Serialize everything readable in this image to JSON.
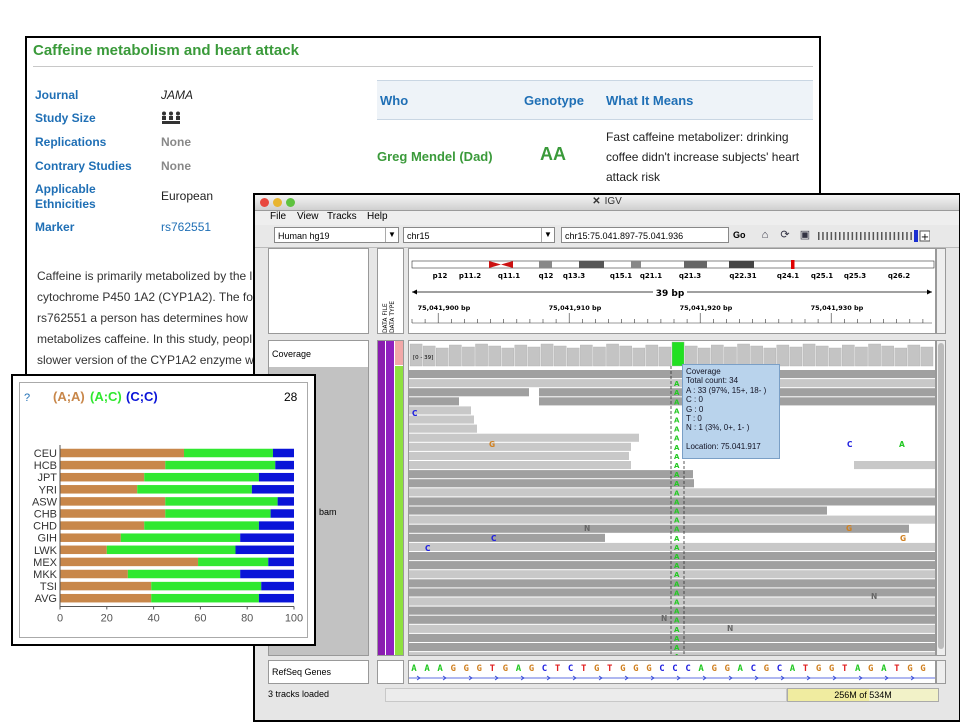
{
  "snpedia": {
    "title": "Caffeine metabolism and heart attack",
    "fields": [
      {
        "key": "Journal",
        "value": "JAMA",
        "style": "ital"
      },
      {
        "key": "Study Size",
        "value": "",
        "style": "icon"
      },
      {
        "key": "Replications",
        "value": "None",
        "style": "gray"
      },
      {
        "key": "Contrary Studies",
        "value": "None",
        "style": "gray"
      },
      {
        "key": "Applicable Ethnicities",
        "value": "European",
        "style": "plain"
      },
      {
        "key": "Marker",
        "value": "rs762551",
        "style": "link"
      }
    ],
    "table": {
      "headers": [
        "Who",
        "Genotype",
        "What It Means"
      ],
      "row": {
        "who": "Greg Mendel (Dad)",
        "genotype": "AA",
        "meaning": "Fast caffeine metabolizer: drinking coffee didn't increase subjects' heart attack risk"
      }
    },
    "body_lines": [
      "Caffeine is primarily metabolized by the l",
      "cytochrome P450 1A2 (CYP1A2). The fo",
      "rs762551 a person has determines how",
      "metabolizes caffeine. In this study, peopl",
      "slower version of the CYP1A2 enzyme w"
    ]
  },
  "chart": {
    "question_mark": "?",
    "count": "28",
    "legend": [
      {
        "label": "(A;A)",
        "color": "#c8874a"
      },
      {
        "label": "(A;C)",
        "color": "#30e830"
      },
      {
        "label": "(C;C)",
        "color": "#0a14d8"
      }
    ]
  },
  "chart_data": {
    "type": "bar",
    "orientation": "horizontal",
    "stacked": true,
    "categories": [
      "CEU",
      "HCB",
      "JPT",
      "YRI",
      "ASW",
      "CHB",
      "CHD",
      "GIH",
      "LWK",
      "MEX",
      "MKK",
      "TSI",
      "AVG"
    ],
    "series": [
      {
        "name": "(A;A)",
        "values": [
          53,
          45,
          36,
          33,
          45,
          45,
          36,
          26,
          20,
          59,
          29,
          39,
          39
        ]
      },
      {
        "name": "(A;C)",
        "values": [
          38,
          47,
          49,
          49,
          48,
          45,
          49,
          51,
          55,
          30,
          48,
          47,
          46
        ]
      },
      {
        "name": "(C;C)",
        "values": [
          9,
          8,
          15,
          18,
          7,
          10,
          15,
          23,
          25,
          11,
          23,
          14,
          15
        ]
      }
    ],
    "xlim": [
      0,
      100
    ],
    "xticks": [
      0,
      20,
      40,
      60,
      80,
      100
    ],
    "grid": false
  },
  "igv": {
    "window_title": "IGV",
    "menus": [
      "File",
      "View",
      "Tracks",
      "Help"
    ],
    "genome": "Human hg19",
    "chromosome": "chr15",
    "locus": "chr15:75.041.897-75.041.936",
    "go_label": "Go",
    "bands": [
      "p12",
      "p11.2",
      "q11.1",
      "q12",
      "q13.3",
      "q15.1",
      "q21.1",
      "q21.3",
      "q22.31",
      "q24.1",
      "q25.1",
      "q25.3",
      "q26.2"
    ],
    "span_label": "39 bp",
    "ruler_labels": [
      "75,041,900 bp",
      "75,041,910 bp",
      "75,041,920 bp",
      "75,041,930 bp"
    ],
    "datafile_label": "DATA FILE",
    "datatype_label": "DATA TYPE",
    "coverage_label": "Coverage",
    "coverage_range": "[0 - 39]",
    "bam_label": "bam",
    "refseq_label": "RefSeq Genes",
    "sequence": "AAAGGGTGAGCTCTGTGGGCCCAGGACGCATGGTAGATGG",
    "tooltip": [
      "Coverage",
      "Total count: 34",
      "A : 33 (97%, 15+, 18- )",
      "C : 0",
      "G : 0",
      "T : 0",
      "N : 1 (3%, 0+, 1- )",
      "",
      "Location: 75.041.917"
    ],
    "status_left": "3 tracks loaded",
    "memory": "256M of 534M",
    "colors": {
      "A": "#22c822",
      "C": "#2020e0",
      "G": "#d08020",
      "T": "#e02020"
    }
  }
}
